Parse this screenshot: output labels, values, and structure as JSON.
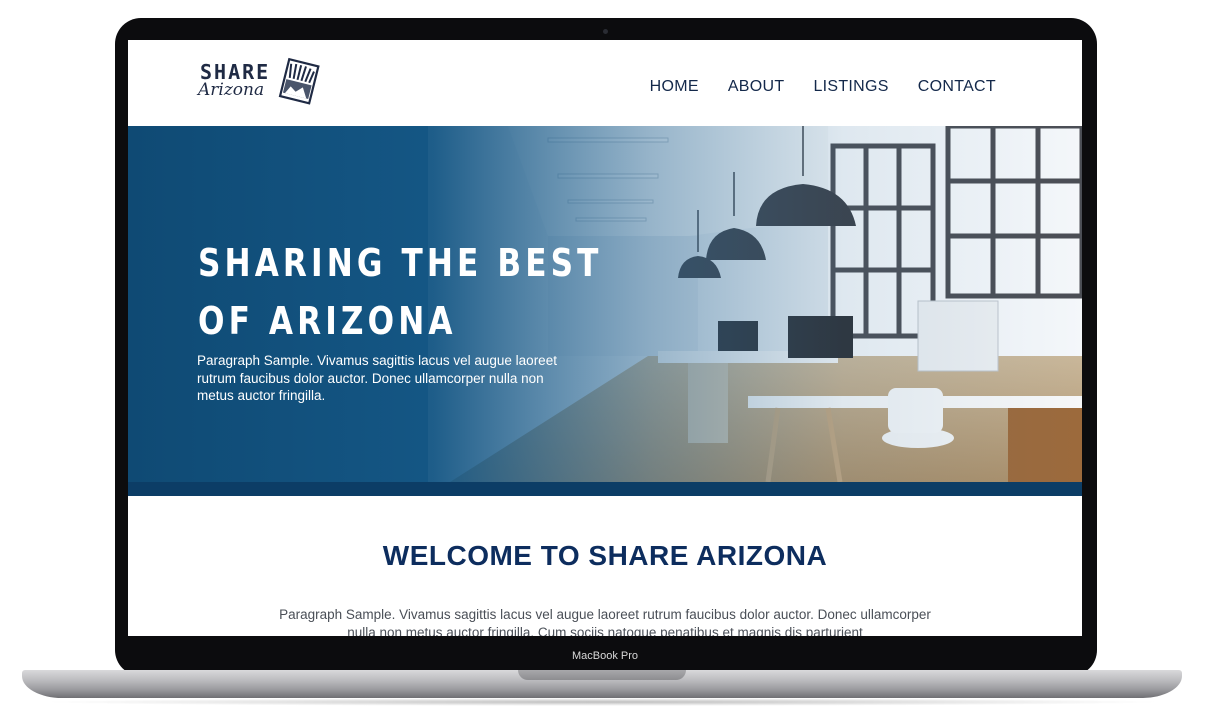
{
  "device": {
    "label": "MacBook Pro"
  },
  "site": {
    "logo": {
      "word": "SHARE",
      "script": "Arizona"
    },
    "nav": [
      {
        "label": "HOME"
      },
      {
        "label": "ABOUT"
      },
      {
        "label": "LISTINGS"
      },
      {
        "label": "CONTACT"
      }
    ],
    "hero": {
      "title_line1": "SHARING THE BEST",
      "title_line2": "OF ARIZONA",
      "paragraph": "Paragraph Sample. Vivamus sagittis lacus vel augue laoreet rutrum faucibus dolor auctor. Donec ullamcorper nulla non metus auctor fringilla."
    },
    "welcome": {
      "title": "WELCOME TO SHARE ARIZONA",
      "paragraph": "Paragraph Sample. Vivamus sagittis lacus vel augue laoreet rutrum faucibus dolor auctor. Donec ullamcorper nulla non metus auctor fringilla. Cum sociis natoque penatibus et magnis dis parturient"
    }
  },
  "colors": {
    "brand_navy": "#0d2d5e",
    "hero_blue": "#0f4a74",
    "hero_bar": "#0c3d66",
    "nav_text": "#13284a"
  }
}
